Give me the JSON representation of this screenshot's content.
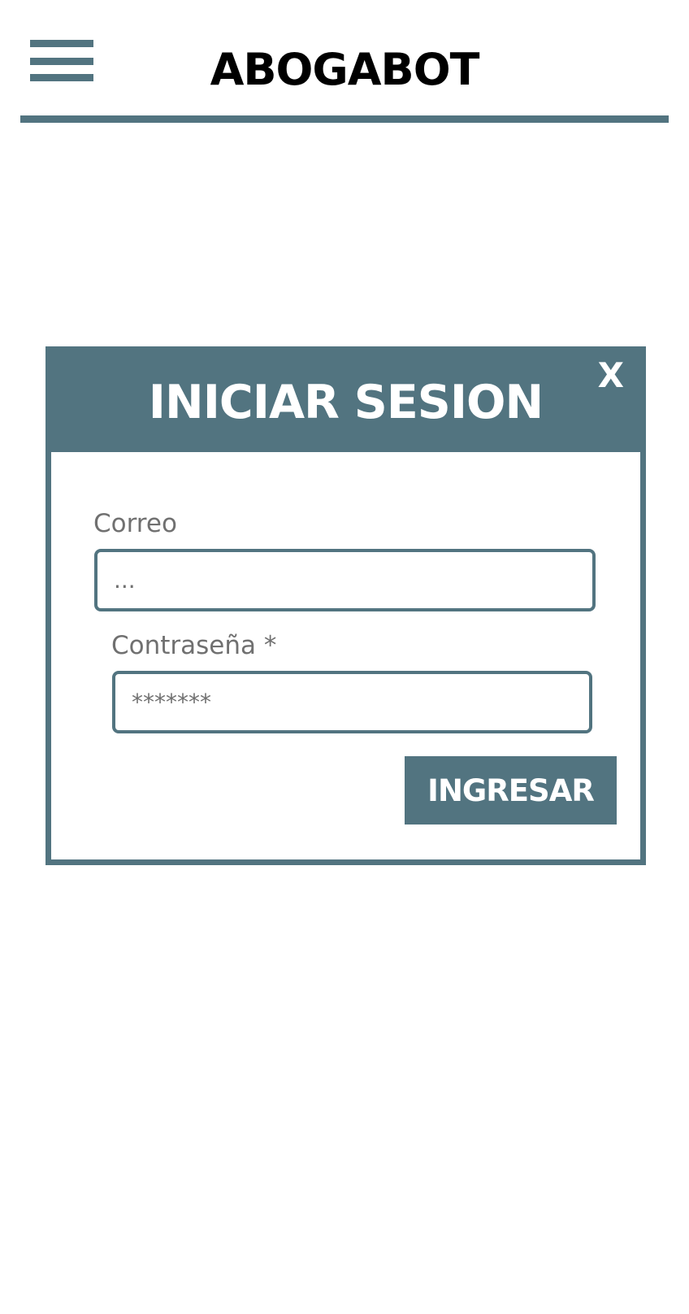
{
  "header": {
    "menu_icon": "hamburger-menu-icon",
    "title": "ABOGABOT"
  },
  "login_modal": {
    "title": "INICIAR SESION",
    "close_label": "X",
    "email": {
      "label": "Correo",
      "placeholder": "..."
    },
    "password": {
      "label": "Contraseña *",
      "placeholder": "*******"
    },
    "submit_label": "INGRESAR"
  },
  "colors": {
    "accent": "#527480",
    "label_text": "#707070",
    "background": "#ffffff"
  }
}
